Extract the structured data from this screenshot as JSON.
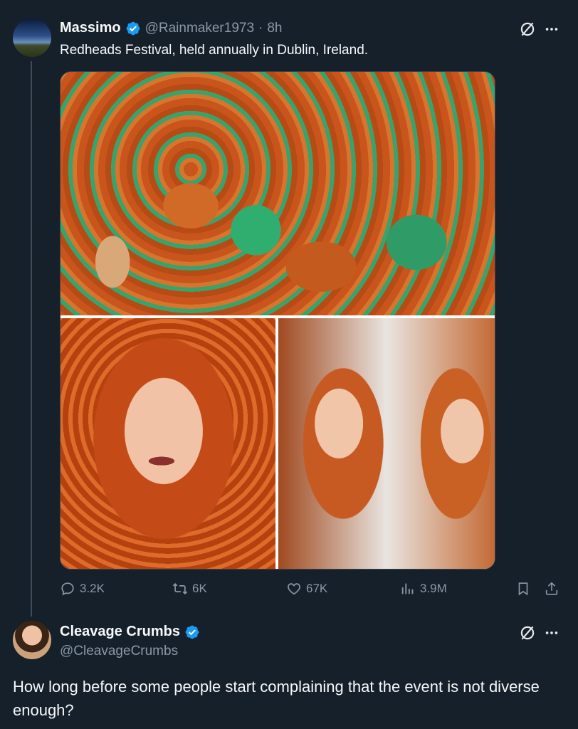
{
  "tweet": {
    "author_name": "Massimo",
    "handle": "@Rainmaker1973",
    "separator": "·",
    "time": "8h",
    "text": "Redheads Festival, held annually in Dublin, Ireland.",
    "stats": {
      "replies": "3.2K",
      "reposts": "6K",
      "likes": "67K",
      "views": "3.9M"
    }
  },
  "reply": {
    "author_name": "Cleavage Crumbs",
    "handle": "@CleavageCrumbs",
    "text": "How long before some people start complaining that the event is not diverse enough?"
  },
  "colors": {
    "background": "#15202b",
    "verified": "#1d9bf0",
    "muted": "#8b98a5"
  },
  "icons": [
    "grok-icon",
    "more-icon",
    "reply-icon",
    "repost-icon",
    "like-icon",
    "views-icon",
    "bookmark-icon",
    "share-icon",
    "verified-badge-icon"
  ]
}
